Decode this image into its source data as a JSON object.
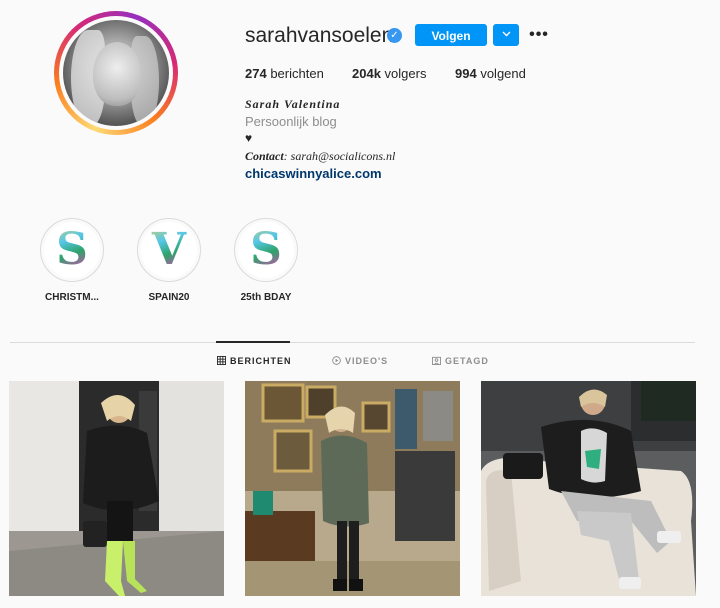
{
  "profile": {
    "username": "sarahvansoelen",
    "verified": true,
    "follow_label": "Volgen",
    "posts_count": "274",
    "posts_label": "berichten",
    "followers_count": "204k",
    "followers_label": "volgers",
    "following_count": "994",
    "following_label": "volgend",
    "full_name": "Sarah Valentina",
    "category": "Persoonlijk blog",
    "bio_emoji": "♥",
    "contact_label": "Contact",
    "contact_value": ": sarah@socialicons.nl",
    "website": "chicaswinnyalice.com"
  },
  "highlights": [
    {
      "letter": "S",
      "label": "CHRISTM..."
    },
    {
      "letter": "V",
      "label": "SPAIN20"
    },
    {
      "letter": "S",
      "label": "25th BDAY"
    }
  ],
  "tabs": [
    {
      "label": "BERICHTEN",
      "active": true,
      "icon": "grid-icon"
    },
    {
      "label": "VIDEO'S",
      "active": false,
      "icon": "video-icon"
    },
    {
      "label": "GETAGD",
      "active": false,
      "icon": "tag-icon"
    }
  ],
  "colors": {
    "accent": "#0095f6",
    "verified": "#3897f0",
    "link": "#00376b",
    "background": "#fafafa"
  }
}
